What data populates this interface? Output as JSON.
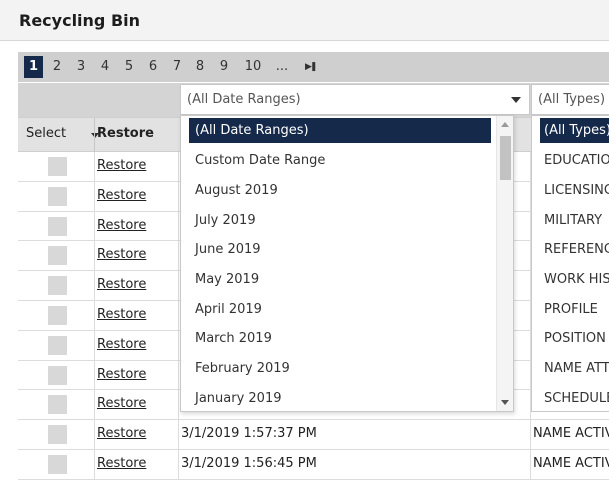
{
  "panel": {
    "title": "Recycling Bin"
  },
  "pager": {
    "pages": [
      "1",
      "2",
      "3",
      "4",
      "5",
      "6",
      "7",
      "8",
      "9",
      "10",
      "..."
    ],
    "active": "1"
  },
  "filters": {
    "date_value": "(All Date Ranges)",
    "type_value": "(All Types)"
  },
  "table": {
    "select_header": "Select",
    "restore_header": "Restore"
  },
  "rows": [
    {
      "restore": "Restore",
      "date": "",
      "type": ""
    },
    {
      "restore": "Restore",
      "date": "",
      "type": ""
    },
    {
      "restore": "Restore",
      "date": "",
      "type": ""
    },
    {
      "restore": "Restore",
      "date": "",
      "type": ""
    },
    {
      "restore": "Restore",
      "date": "",
      "type": ""
    },
    {
      "restore": "Restore",
      "date": "",
      "type": ""
    },
    {
      "restore": "Restore",
      "date": "",
      "type": ""
    },
    {
      "restore": "Restore",
      "date": "",
      "type": ""
    },
    {
      "restore": "Restore",
      "date": "",
      "type": ""
    },
    {
      "restore": "Restore",
      "date": "3/1/2019 1:57:37 PM",
      "type": "NAME ACTIV"
    },
    {
      "restore": "Restore",
      "date": "3/1/2019 1:56:45 PM",
      "type": "NAME ACTIV"
    }
  ],
  "date_dropdown": {
    "options": [
      "(All Date Ranges)",
      "Custom Date Range",
      "August 2019",
      "July 2019",
      "June 2019",
      "May 2019",
      "April 2019",
      "March 2019",
      "February 2019",
      "January 2019"
    ],
    "selected_index": 0
  },
  "type_dropdown": {
    "options": [
      "(All Types)",
      "EDUCATIO",
      "LICENSING",
      "MILITARY",
      "REFERENC",
      "WORK HIS",
      "PROFILE",
      "POSITION",
      "NAME ATT",
      "SCHEDULE"
    ],
    "selected_index": 0
  },
  "colors": {
    "accent": "#15294b",
    "pager_bg": "#cfcfcf",
    "header_bg": "#e2e2e2"
  }
}
